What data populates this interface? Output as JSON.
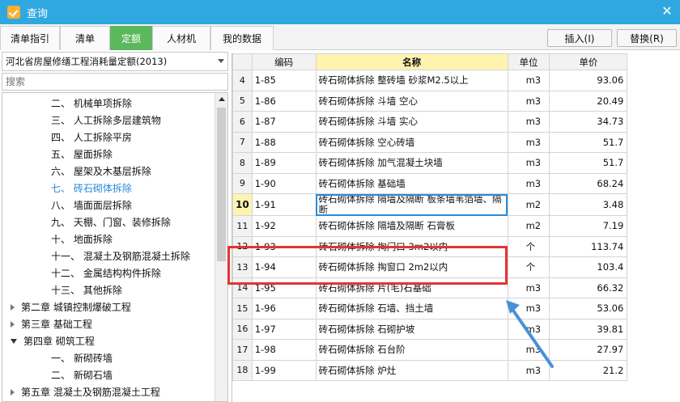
{
  "window": {
    "title": "查询"
  },
  "tabs": [
    {
      "label": "清单指引",
      "active": false
    },
    {
      "label": "清单",
      "active": false
    },
    {
      "label": "定额",
      "active": true
    },
    {
      "label": "人材机",
      "active": false
    },
    {
      "label": "我的数据",
      "active": false
    }
  ],
  "buttons": {
    "insert": "插入(I)",
    "replace": "替换(R)"
  },
  "library": {
    "selected": "河北省房屋修缮工程消耗量定额(2013)"
  },
  "search": {
    "placeholder": "搜索"
  },
  "tree": [
    {
      "label": "二、 机械单项拆除",
      "level": 2
    },
    {
      "label": "三、 人工拆除多层建筑物",
      "level": 2
    },
    {
      "label": "四、 人工拆除平房",
      "level": 2
    },
    {
      "label": "五、 屋面拆除",
      "level": 2
    },
    {
      "label": "六、 屋架及木基层拆除",
      "level": 2
    },
    {
      "label": "七、 砖石砌体拆除",
      "level": 2,
      "active": true
    },
    {
      "label": "八、 墙面面层拆除",
      "level": 2
    },
    {
      "label": "九、 天棚、门窗、装修拆除",
      "level": 2
    },
    {
      "label": "十、 地面拆除",
      "level": 2
    },
    {
      "label": "十一、 混凝土及钢筋混凝土拆除",
      "level": 2
    },
    {
      "label": "十二、 金属结构构件拆除",
      "level": 2
    },
    {
      "label": "十三、 其他拆除",
      "level": 2
    },
    {
      "label": "第二章 城镇控制爆破工程",
      "level": 1,
      "state": "collapsed"
    },
    {
      "label": "第三章 基础工程",
      "level": 1,
      "state": "collapsed"
    },
    {
      "label": "第四章 砌筑工程",
      "level": 1,
      "state": "expanded"
    },
    {
      "label": "一、 新砌砖墙",
      "level": 2
    },
    {
      "label": "二、 新砌石墙",
      "level": 2
    },
    {
      "label": "第五章 混凝土及钢筋混凝土工程",
      "level": 1,
      "state": "collapsed"
    }
  ],
  "grid": {
    "columns": [
      "",
      "编码",
      "名称",
      "单位",
      "单价"
    ],
    "rows": [
      {
        "num": "4",
        "code": "1-85",
        "name": "砖石砌体拆除 整砖墙 砂浆M2.5以上",
        "unit": "m3",
        "price": "93.06"
      },
      {
        "num": "5",
        "code": "1-86",
        "name": "砖石砌体拆除 斗墙 空心",
        "unit": "m3",
        "price": "20.49"
      },
      {
        "num": "6",
        "code": "1-87",
        "name": "砖石砌体拆除 斗墙 实心",
        "unit": "m3",
        "price": "34.73"
      },
      {
        "num": "7",
        "code": "1-88",
        "name": "砖石砌体拆除 空心砖墙",
        "unit": "m3",
        "price": "51.7"
      },
      {
        "num": "8",
        "code": "1-89",
        "name": "砖石砌体拆除 加气混凝土块墙",
        "unit": "m3",
        "price": "51.7"
      },
      {
        "num": "9",
        "code": "1-90",
        "name": "砖石砌体拆除 基础墙",
        "unit": "m3",
        "price": "68.24"
      },
      {
        "num": "10",
        "code": "1-91",
        "name": "砖石砌体拆除 隔墙及隔断 板条墙苇箔墙、隔断",
        "unit": "m2",
        "price": "3.48",
        "current": true
      },
      {
        "num": "11",
        "code": "1-92",
        "name": "砖石砌体拆除 隔墙及隔断 石膏板",
        "unit": "m2",
        "price": "7.19"
      },
      {
        "num": "12",
        "code": "1-93",
        "name": "砖石砌体拆除 掏门口 3m2以内",
        "unit": "个",
        "price": "113.74"
      },
      {
        "num": "13",
        "code": "1-94",
        "name": "砖石砌体拆除 掏窗口 2m2以内",
        "unit": "个",
        "price": "103.4"
      },
      {
        "num": "14",
        "code": "1-95",
        "name": "砖石砌体拆除 片(毛)石基础",
        "unit": "m3",
        "price": "66.32"
      },
      {
        "num": "15",
        "code": "1-96",
        "name": "砖石砌体拆除 石墙、挡土墙",
        "unit": "m3",
        "price": "53.06"
      },
      {
        "num": "16",
        "code": "1-97",
        "name": "砖石砌体拆除 石砌护坡",
        "unit": "m3",
        "price": "39.81"
      },
      {
        "num": "17",
        "code": "1-98",
        "name": "砖石砌体拆除 石台阶",
        "unit": "m3",
        "price": "27.97"
      },
      {
        "num": "18",
        "code": "1-99",
        "name": "砖石砌体拆除 炉灶",
        "unit": "m3",
        "price": "21.2"
      }
    ]
  },
  "colors": {
    "titlebar": "#2fa8e0",
    "active_tab": "#5cb85c",
    "highlight": "#e53333",
    "arrow": "#4a90d9"
  },
  "icons": {
    "app": "app-logo-icon",
    "close": "close-icon"
  }
}
